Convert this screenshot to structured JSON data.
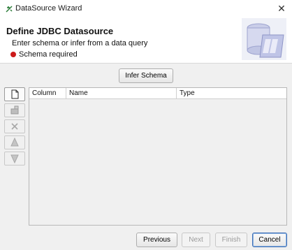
{
  "window": {
    "title": "DataSource Wizard"
  },
  "header": {
    "title": "Define JDBC Datasource",
    "subtitle": "Enter schema or infer from a data query",
    "status_text": "Schema required",
    "status_color": "#cc1a1a"
  },
  "toolbar": {
    "infer_label": "Infer Schema"
  },
  "side_tools": [
    {
      "name": "new-row-icon",
      "enabled": true
    },
    {
      "name": "table-add-icon",
      "enabled": false
    },
    {
      "name": "delete-icon",
      "enabled": false
    },
    {
      "name": "move-up-icon",
      "enabled": false
    },
    {
      "name": "move-down-icon",
      "enabled": false
    }
  ],
  "table": {
    "columns": [
      "Column",
      "Name",
      "Type"
    ],
    "rows": []
  },
  "footer": {
    "previous_label": "Previous",
    "next_label": "Next",
    "finish_label": "Finish",
    "cancel_label": "Cancel"
  }
}
